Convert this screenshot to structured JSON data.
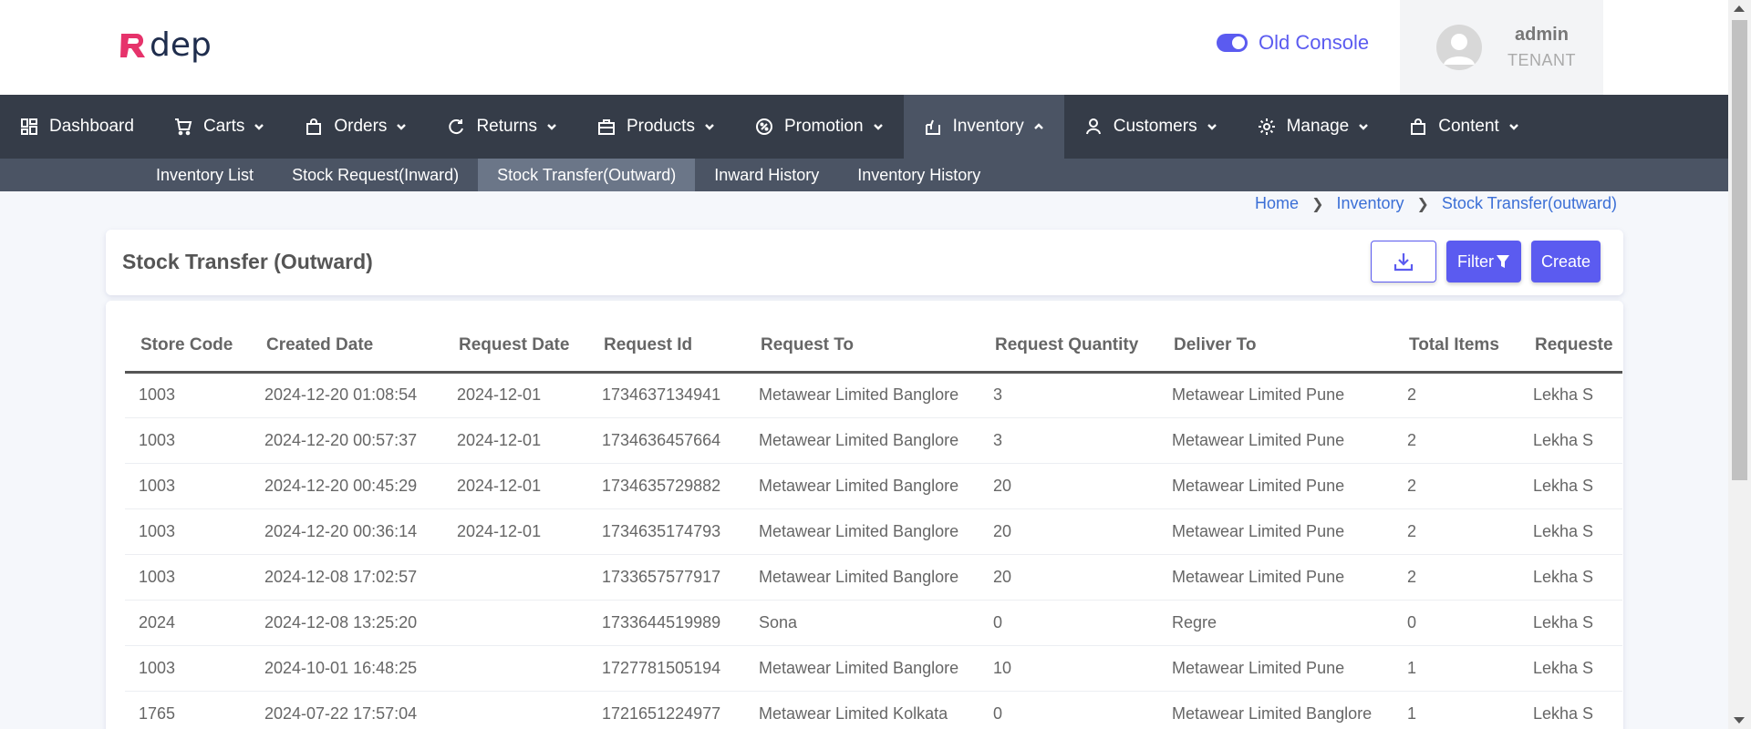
{
  "header": {
    "logo_text": "dep",
    "toggle_label": "Old Console",
    "user": {
      "name": "admin",
      "role": "TENANT"
    }
  },
  "nav": {
    "items": [
      {
        "label": "Dashboard",
        "icon": "dashboard-icon",
        "dropdown": false
      },
      {
        "label": "Carts",
        "icon": "cart-icon",
        "dropdown": true
      },
      {
        "label": "Orders",
        "icon": "bag-icon",
        "dropdown": true
      },
      {
        "label": "Returns",
        "icon": "refresh-icon",
        "dropdown": true
      },
      {
        "label": "Products",
        "icon": "briefcase-icon",
        "dropdown": true
      },
      {
        "label": "Promotion",
        "icon": "badge-icon",
        "dropdown": true
      },
      {
        "label": "Inventory",
        "icon": "box-icon",
        "dropdown": true,
        "active": true
      },
      {
        "label": "Customers",
        "icon": "user-icon",
        "dropdown": true
      },
      {
        "label": "Manage",
        "icon": "gear-icon",
        "dropdown": true
      },
      {
        "label": "Content",
        "icon": "bag-icon",
        "dropdown": true
      }
    ],
    "subitems": [
      "Inventory List",
      "Stock Request(Inward)",
      "Stock Transfer(Outward)",
      "Inward History",
      "Inventory History"
    ],
    "active_sub": "Stock Transfer(Outward)"
  },
  "breadcrumb": [
    "Home",
    "Inventory",
    "Stock Transfer(outward)"
  ],
  "page": {
    "title": "Stock Transfer (Outward)",
    "filter_label": "Filter",
    "create_label": "Create"
  },
  "table": {
    "columns": [
      "Store Code",
      "Created Date",
      "Request Date",
      "Request Id",
      "Request To",
      "Request Quantity",
      "Deliver To",
      "Total Items",
      "Requeste"
    ],
    "rows": [
      [
        "1003",
        "2024-12-20 01:08:54",
        "2024-12-01",
        "1734637134941",
        "Metawear Limited Banglore",
        "3",
        "Metawear Limited Pune",
        "2",
        "Lekha S"
      ],
      [
        "1003",
        "2024-12-20 00:57:37",
        "2024-12-01",
        "1734636457664",
        "Metawear Limited Banglore",
        "3",
        "Metawear Limited Pune",
        "2",
        "Lekha S"
      ],
      [
        "1003",
        "2024-12-20 00:45:29",
        "2024-12-01",
        "1734635729882",
        "Metawear Limited Banglore",
        "20",
        "Metawear Limited Pune",
        "2",
        "Lekha S"
      ],
      [
        "1003",
        "2024-12-20 00:36:14",
        "2024-12-01",
        "1734635174793",
        "Metawear Limited Banglore",
        "20",
        "Metawear Limited Pune",
        "2",
        "Lekha S"
      ],
      [
        "1003",
        "2024-12-08 17:02:57",
        "",
        "1733657577917",
        "Metawear Limited Banglore",
        "20",
        "Metawear Limited Pune",
        "2",
        "Lekha S"
      ],
      [
        "2024",
        "2024-12-08 13:25:20",
        "",
        "1733644519989",
        "Sona",
        "0",
        "Regre",
        "0",
        "Lekha S"
      ],
      [
        "1003",
        "2024-10-01 16:48:25",
        "",
        "1727781505194",
        "Metawear Limited Banglore",
        "10",
        "Metawear Limited Pune",
        "1",
        "Lekha S"
      ],
      [
        "1765",
        "2024-07-22 17:57:04",
        "",
        "1721651224977",
        "Metawear Limited Kolkata",
        "0",
        "Metawear Limited Banglore",
        "1",
        "Lekha S"
      ]
    ]
  }
}
